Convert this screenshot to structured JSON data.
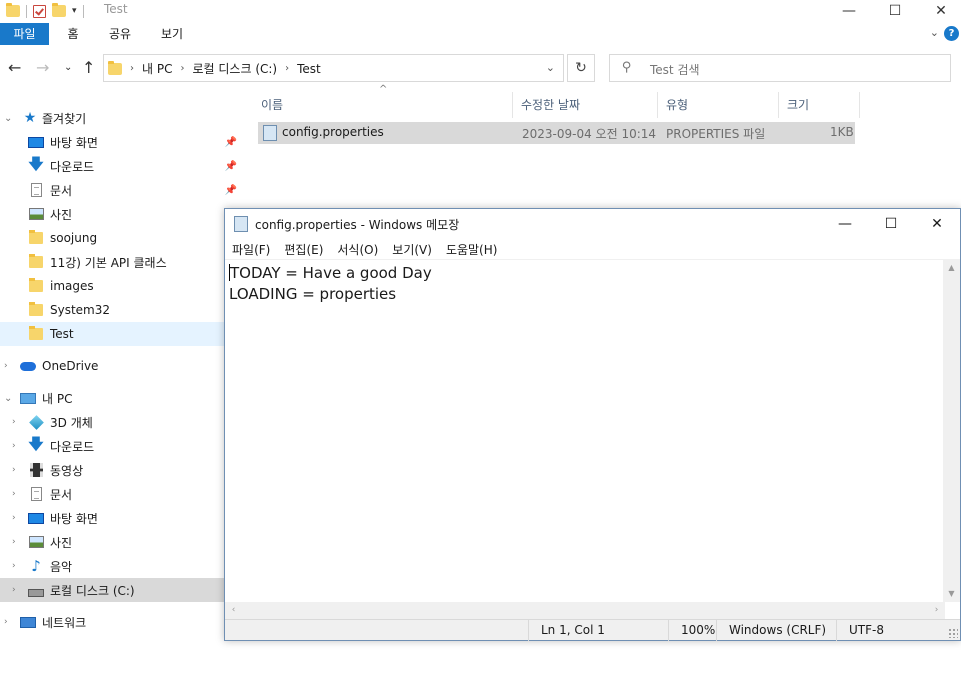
{
  "explorer": {
    "title": "Test",
    "ribbon_tabs": [
      {
        "label": "파일",
        "active": true
      },
      {
        "label": "홈",
        "active": false
      },
      {
        "label": "공유",
        "active": false
      },
      {
        "label": "보기",
        "active": false
      }
    ],
    "help_glyph": "?",
    "address": {
      "crumbs": [
        "내 PC",
        "로컬 디스크 (C:)",
        "Test"
      ]
    },
    "search": {
      "placeholder": "Test 검색"
    },
    "sidebar": {
      "quick_access": "즐겨찾기",
      "quick_items": [
        {
          "label": "바탕 화면",
          "icon": "desktop-icon",
          "pinned": true
        },
        {
          "label": "다운로드",
          "icon": "download-icon",
          "pinned": true
        },
        {
          "label": "문서",
          "icon": "document-icon",
          "pinned": true
        },
        {
          "label": "사진",
          "icon": "picture-icon",
          "pinned": false
        },
        {
          "label": "soojung",
          "icon": "folder-icon",
          "pinned": false
        },
        {
          "label": "11강) 기본 API 클래스",
          "icon": "folder-icon",
          "pinned": false
        },
        {
          "label": "images",
          "icon": "folder-icon",
          "pinned": false
        },
        {
          "label": "System32",
          "icon": "folder-icon",
          "pinned": false
        },
        {
          "label": "Test",
          "icon": "folder-icon",
          "pinned": false,
          "selected": true
        }
      ],
      "onedrive": "OneDrive",
      "this_pc": "내 PC",
      "pc_items": [
        {
          "label": "3D 개체",
          "icon": "3d-objects-icon"
        },
        {
          "label": "다운로드",
          "icon": "download-icon"
        },
        {
          "label": "동영상",
          "icon": "video-icon"
        },
        {
          "label": "문서",
          "icon": "document-icon"
        },
        {
          "label": "바탕 화면",
          "icon": "desktop-icon"
        },
        {
          "label": "사진",
          "icon": "picture-icon"
        },
        {
          "label": "음악",
          "icon": "music-icon"
        },
        {
          "label": "로컬 디스크 (C:)",
          "icon": "drive-icon",
          "hover": true
        }
      ],
      "network": "네트워크"
    },
    "columns": [
      "이름",
      "수정한 날짜",
      "유형",
      "크기"
    ],
    "files": [
      {
        "name": "config.properties",
        "modified": "2023-09-04 오전 10:14",
        "type": "PROPERTIES 파일",
        "size": "1KB"
      }
    ]
  },
  "notepad": {
    "title": "config.properties - Windows 메모장",
    "menu": [
      "파일(F)",
      "편집(E)",
      "서식(O)",
      "보기(V)",
      "도움말(H)"
    ],
    "lines": [
      "TODAY = Have a good Day",
      "LOADING = properties"
    ],
    "status": {
      "position": "Ln 1, Col 1",
      "zoom": "100%",
      "line_ending": "Windows (CRLF)",
      "encoding": "UTF-8"
    }
  },
  "colors": {
    "accent": "#1979ca",
    "selection": "#e5f3ff",
    "row_highlight": "#d9d9d9"
  }
}
